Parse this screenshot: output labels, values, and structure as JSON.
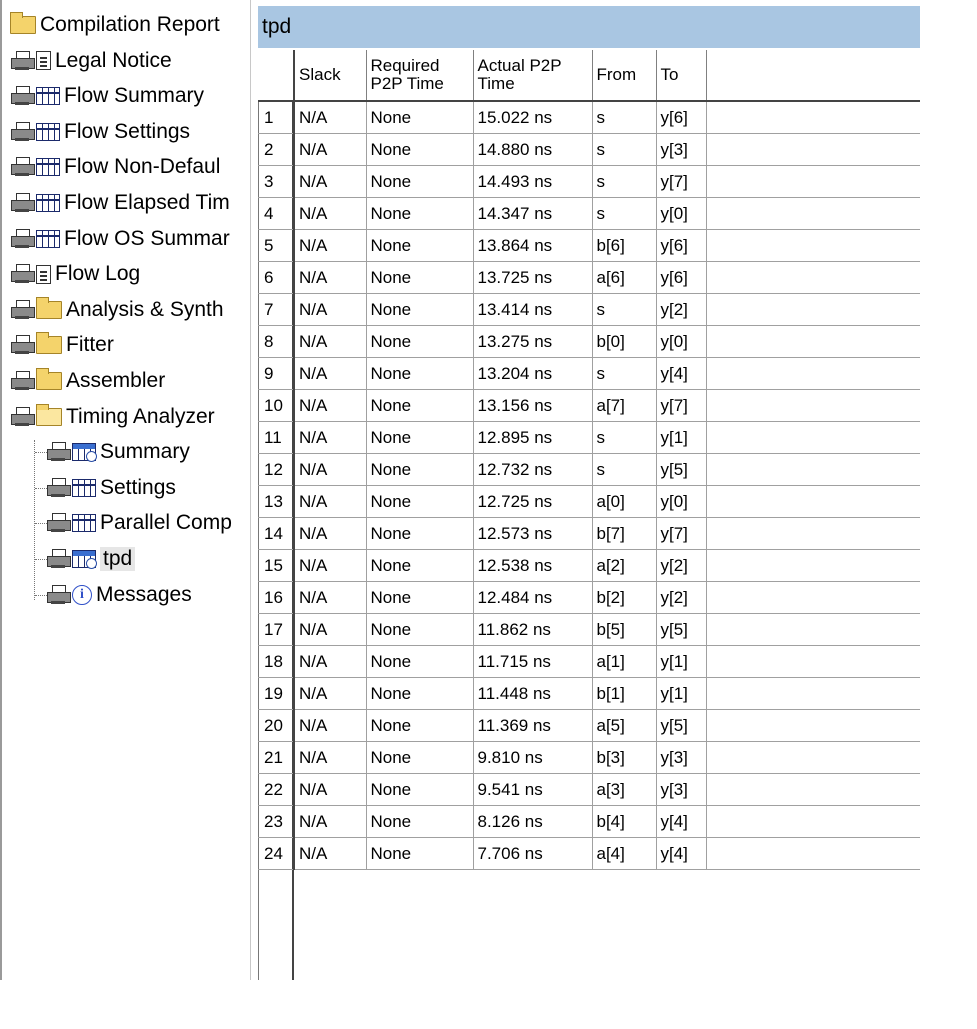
{
  "tree": {
    "items": [
      {
        "label": "Compilation Report",
        "icon": "report-folder-icon",
        "level": 0
      },
      {
        "label": "Legal Notice",
        "icon": "document-icon",
        "level": 1
      },
      {
        "label": "Flow Summary",
        "icon": "table-icon",
        "level": 1
      },
      {
        "label": "Flow Settings",
        "icon": "table-icon",
        "level": 1
      },
      {
        "label": "Flow Non-Defaul",
        "icon": "table-icon",
        "level": 1
      },
      {
        "label": "Flow Elapsed Tim",
        "icon": "table-icon",
        "level": 1
      },
      {
        "label": "Flow OS Summar",
        "icon": "table-icon",
        "level": 1
      },
      {
        "label": "Flow Log",
        "icon": "document-icon",
        "level": 1
      },
      {
        "label": "Analysis & Synth",
        "icon": "folder-icon",
        "level": 1
      },
      {
        "label": "Fitter",
        "icon": "folder-icon",
        "level": 1
      },
      {
        "label": "Assembler",
        "icon": "folder-icon",
        "level": 1
      },
      {
        "label": "Timing Analyzer",
        "icon": "open-folder-icon",
        "level": 1
      },
      {
        "label": "Summary",
        "icon": "timing-table-icon",
        "level": 2
      },
      {
        "label": "Settings",
        "icon": "table-icon",
        "level": 2
      },
      {
        "label": "Parallel Comp",
        "icon": "table-icon",
        "level": 2
      },
      {
        "label": "tpd",
        "icon": "timing-table-icon",
        "level": 2,
        "selected": true
      },
      {
        "label": "Messages",
        "icon": "info-icon",
        "level": 2
      }
    ]
  },
  "report": {
    "title": "tpd",
    "columns": [
      "Slack",
      "Required P2P Time",
      "Actual P2P Time",
      "From",
      "To"
    ],
    "column_lines": [
      [
        "Slack"
      ],
      [
        "Required",
        "P2P Time"
      ],
      [
        "Actual P2P",
        "Time"
      ],
      [
        "From"
      ],
      [
        "To"
      ]
    ],
    "rows": [
      {
        "n": "1",
        "slack": "N/A",
        "required": "None",
        "actual": "15.022 ns",
        "from": "s",
        "to": "y[6]"
      },
      {
        "n": "2",
        "slack": "N/A",
        "required": "None",
        "actual": "14.880 ns",
        "from": "s",
        "to": "y[3]"
      },
      {
        "n": "3",
        "slack": "N/A",
        "required": "None",
        "actual": "14.493 ns",
        "from": "s",
        "to": "y[7]"
      },
      {
        "n": "4",
        "slack": "N/A",
        "required": "None",
        "actual": "14.347 ns",
        "from": "s",
        "to": "y[0]"
      },
      {
        "n": "5",
        "slack": "N/A",
        "required": "None",
        "actual": "13.864 ns",
        "from": "b[6]",
        "to": "y[6]"
      },
      {
        "n": "6",
        "slack": "N/A",
        "required": "None",
        "actual": "13.725 ns",
        "from": "a[6]",
        "to": "y[6]"
      },
      {
        "n": "7",
        "slack": "N/A",
        "required": "None",
        "actual": "13.414 ns",
        "from": "s",
        "to": "y[2]"
      },
      {
        "n": "8",
        "slack": "N/A",
        "required": "None",
        "actual": "13.275 ns",
        "from": "b[0]",
        "to": "y[0]"
      },
      {
        "n": "9",
        "slack": "N/A",
        "required": "None",
        "actual": "13.204 ns",
        "from": "s",
        "to": "y[4]"
      },
      {
        "n": "10",
        "slack": "N/A",
        "required": "None",
        "actual": "13.156 ns",
        "from": "a[7]",
        "to": "y[7]"
      },
      {
        "n": "11",
        "slack": "N/A",
        "required": "None",
        "actual": "12.895 ns",
        "from": "s",
        "to": "y[1]"
      },
      {
        "n": "12",
        "slack": "N/A",
        "required": "None",
        "actual": "12.732 ns",
        "from": "s",
        "to": "y[5]"
      },
      {
        "n": "13",
        "slack": "N/A",
        "required": "None",
        "actual": "12.725 ns",
        "from": "a[0]",
        "to": "y[0]"
      },
      {
        "n": "14",
        "slack": "N/A",
        "required": "None",
        "actual": "12.573 ns",
        "from": "b[7]",
        "to": "y[7]"
      },
      {
        "n": "15",
        "slack": "N/A",
        "required": "None",
        "actual": "12.538 ns",
        "from": "a[2]",
        "to": "y[2]"
      },
      {
        "n": "16",
        "slack": "N/A",
        "required": "None",
        "actual": "12.484 ns",
        "from": "b[2]",
        "to": "y[2]"
      },
      {
        "n": "17",
        "slack": "N/A",
        "required": "None",
        "actual": "11.862 ns",
        "from": "b[5]",
        "to": "y[5]"
      },
      {
        "n": "18",
        "slack": "N/A",
        "required": "None",
        "actual": "11.715 ns",
        "from": "a[1]",
        "to": "y[1]"
      },
      {
        "n": "19",
        "slack": "N/A",
        "required": "None",
        "actual": "11.448 ns",
        "from": "b[1]",
        "to": "y[1]"
      },
      {
        "n": "20",
        "slack": "N/A",
        "required": "None",
        "actual": "11.369 ns",
        "from": "a[5]",
        "to": "y[5]"
      },
      {
        "n": "21",
        "slack": "N/A",
        "required": "None",
        "actual": "9.810 ns",
        "from": "b[3]",
        "to": "y[3]"
      },
      {
        "n": "22",
        "slack": "N/A",
        "required": "None",
        "actual": "9.541 ns",
        "from": "a[3]",
        "to": "y[3]"
      },
      {
        "n": "23",
        "slack": "N/A",
        "required": "None",
        "actual": "8.126 ns",
        "from": "b[4]",
        "to": "y[4]"
      },
      {
        "n": "24",
        "slack": "N/A",
        "required": "None",
        "actual": "7.706 ns",
        "from": "a[4]",
        "to": "y[4]"
      }
    ]
  },
  "colors": {
    "title_bar": "#a9c6e2",
    "folder": "#f4d36b",
    "selected_bg": "#e6e6e6"
  }
}
